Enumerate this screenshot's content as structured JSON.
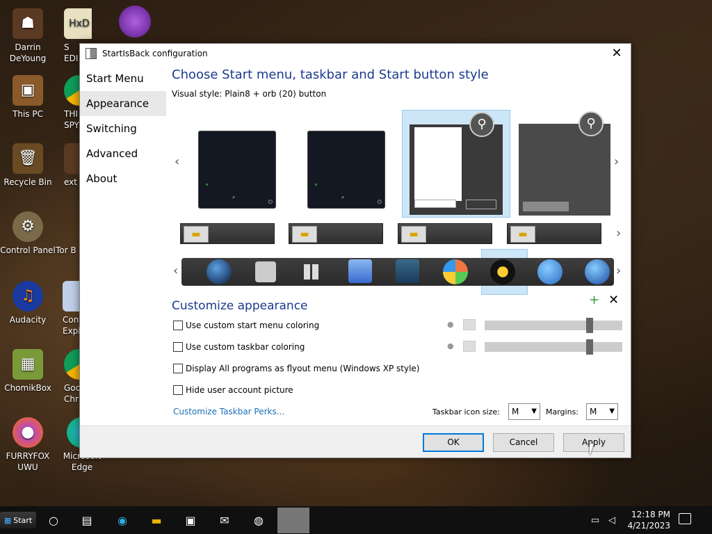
{
  "desktop": {
    "icons": [
      {
        "label": "Darrin DeYoung",
        "icon": "person-icon"
      },
      {
        "label": "This PC",
        "icon": "computer-icon"
      },
      {
        "label": "Recycle Bin",
        "icon": "recycle-bin-icon"
      },
      {
        "label": "Control Panel",
        "icon": "control-panel-icon"
      },
      {
        "label": "Audacity",
        "icon": "audacity-icon"
      },
      {
        "label": "ChomikBox",
        "icon": "chomikbox-icon"
      },
      {
        "label": "FURRYFOX UWU",
        "icon": "firefox-icon"
      }
    ],
    "partial_icons": [
      {
        "label": "S\nEDI",
        "icon": "hxd-icon"
      },
      {
        "label": "THI\nSPY",
        "icon": "chrome-icon"
      },
      {
        "label": "ext",
        "icon": "app-icon"
      },
      {
        "label": "Tor B",
        "icon": "tor-icon"
      },
      {
        "label": "Conf\nExplo",
        "icon": "config-icon"
      },
      {
        "label": "Goo\nChr",
        "icon": "chrome-icon"
      },
      {
        "label": "Microsoft Edge",
        "icon": "edge-icon"
      }
    ],
    "tor_icon": "tor-icon"
  },
  "dialog": {
    "title": "StartIsBack configuration",
    "nav": [
      "Start Menu",
      "Appearance",
      "Switching",
      "Advanced",
      "About"
    ],
    "active_nav": "Appearance",
    "heading": "Choose Start menu, taskbar and Start button style",
    "visual_style_label": "Visual style:",
    "visual_style_value": "Plain8 + orb (20) button",
    "customize_heading": "Customize appearance",
    "options": [
      {
        "label": "Use custom start menu coloring",
        "checked": false
      },
      {
        "label": "Use custom taskbar coloring",
        "checked": false
      },
      {
        "label": "Display All programs as flyout menu (Windows XP style)",
        "checked": false
      },
      {
        "label": "Hide user account picture",
        "checked": false
      }
    ],
    "perks_link": "Customize Taskbar Perks...",
    "taskbar_icon_size_label": "Taskbar icon size:",
    "taskbar_icon_size_value": "M",
    "margins_label": "Margins:",
    "margins_value": "M",
    "buttons": {
      "ok": "OK",
      "cancel": "Cancel",
      "apply": "Apply"
    }
  },
  "taskbar": {
    "start_label": "Start",
    "time": "12:18 PM",
    "date": "4/21/2023"
  },
  "colors": {
    "accent": "#0078d7",
    "heading": "#1b3a8c",
    "selection": "#cde6f7"
  }
}
